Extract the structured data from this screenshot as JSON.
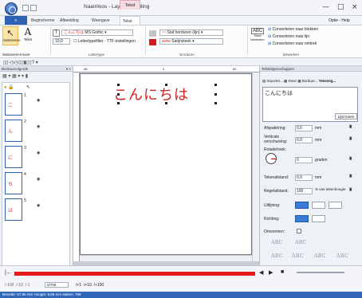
{
  "window": {
    "title": "Naamloos - Layout & Editing",
    "context_tab": "Tekst",
    "min": "—",
    "max": "□",
    "close": "×",
    "options": "Optie - Help"
  },
  "tabs": [
    "Begincherme",
    "Afbeelding",
    "Weergave",
    "Tekst"
  ],
  "ribbon": {
    "select_label": "Selecteren",
    "move_label": "Invoer",
    "text_label": "Tekst",
    "font_chars": "こんにちは",
    "font_name": "MS Gothic",
    "size": "10,0",
    "letter_filter": "Lettertypefilter",
    "ttf_settings": "TTF-instellingen",
    "group_font": "Lettertype",
    "stitch1": "Staf borduren (lijn)",
    "stitch2": "Satijnsteek",
    "group_borduren": "Borduren",
    "edit_label": "Tekst bewerken",
    "conv1": "Converteren naar blokken",
    "conv2": "Converteren naar lijn",
    "conv3": "Converteren naar omtrek",
    "group_edit": "Bewerken"
  },
  "left_panel": {
    "title": "Borduurvolgorde",
    "items": [
      {
        "num": "1",
        "char": "こ"
      },
      {
        "num": "2",
        "char": "ん"
      },
      {
        "num": "3",
        "char": "に"
      },
      {
        "num": "4",
        "char": "ち"
      },
      {
        "num": "5",
        "char": "は"
      }
    ]
  },
  "canvas": {
    "text": "こんにちは",
    "ruler_marks": [
      "-60",
      "0",
      "60"
    ]
  },
  "right_panel": {
    "title": "Tekstelgenschappen",
    "tabs": [
      "Importer...",
      "Kleur",
      "Borduur...",
      "Teksteig..."
    ],
    "text_value": "こんにちは",
    "list_button": "Lijst tonen",
    "afspatiering": {
      "label": "Afspatiëring:",
      "value": "0,0",
      "unit": "mm"
    },
    "verticale": {
      "label": "Verticale verschuiving:",
      "value": "0,0",
      "unit": "mm"
    },
    "rotatie": {
      "label": "Rotatiehoek:",
      "value": "0",
      "unit": "graden"
    },
    "tekenafstand": {
      "label": "Tekenafstand:",
      "value": "0,0",
      "unit": "mm"
    },
    "regelafstand": {
      "label": "Regelafstand:",
      "value": "100",
      "unit": "% van tekenhoogte"
    },
    "uitlijning_label": "Uitlijning:",
    "richting_label": "Richting:",
    "omvormen_label": "Omvormen:",
    "styles": [
      "ABC",
      "ABC",
      "ABC",
      "ABC",
      "ABC",
      "ABC"
    ]
  },
  "timeline": {
    "counter": "0/769",
    "buttons": [
      "|←",
      "◀",
      "▶",
      "■"
    ],
    "steps": [
      "/-100",
      "/-10",
      "/-1",
      "/+1",
      "/+10",
      "/+100"
    ]
  },
  "statusbar": {
    "text": "Breedte: 57,96 mm  Hoogte: 9,86 mm  steken: 769"
  }
}
